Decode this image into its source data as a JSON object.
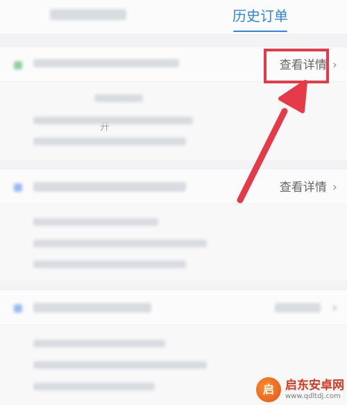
{
  "tabs": [
    {
      "label": "",
      "active": false
    },
    {
      "label": "历史订单",
      "active": true
    }
  ],
  "orders": [
    {
      "route": "",
      "detail_label": "查看详情",
      "dot_color": "#8fd09a",
      "rows": [
        {
          "label": "",
          "value": ""
        },
        {
          "label": "",
          "value": "",
          "extra": "开"
        },
        {
          "label": "",
          "value": ""
        }
      ]
    },
    {
      "route": "",
      "detail_label": "查看详情",
      "dot_color": "#9bb8f0",
      "rows": [
        {
          "label": "",
          "value": ""
        },
        {
          "label": "",
          "value": ""
        },
        {
          "label": "",
          "value": ""
        }
      ]
    },
    {
      "route": "",
      "detail_label": "",
      "dot_color": "#9bb8f0",
      "rows": [
        {
          "label": "",
          "value": ""
        },
        {
          "label": "",
          "value": ""
        },
        {
          "label": "",
          "value": ""
        }
      ]
    }
  ],
  "chevron": "›",
  "annotation": {
    "highlight_color": "#e53a4a"
  },
  "watermark": {
    "title": "启东安卓网",
    "url": "www.qdltdj.com",
    "logo": "启"
  },
  "colors": {
    "accent": "#2b86e8"
  }
}
